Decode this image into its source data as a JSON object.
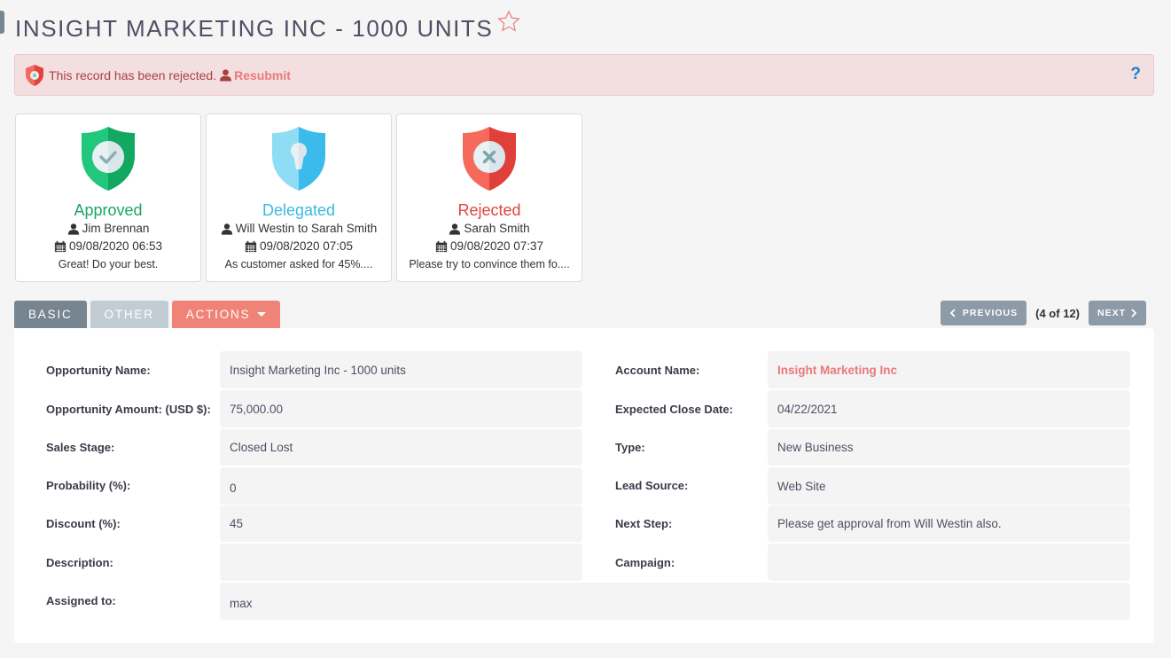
{
  "header": {
    "title": "INSIGHT MARKETING INC - 1000 UNITS",
    "favorite_icon": "star-outline-icon"
  },
  "alert": {
    "icon": "shield-reject-icon",
    "message": "This record has been rejected.",
    "action_icon": "user-icon",
    "action_label": "Resubmit",
    "help_label": "?"
  },
  "approvals": [
    {
      "status": "Approved",
      "color": "#1aa766",
      "user": "Jim Brennan",
      "datetime": "09/08/2020 06:53",
      "comment": "Great! Do your best.",
      "icon": "shield-check-icon"
    },
    {
      "status": "Delegated",
      "color": "#3db8e2",
      "user": "Will Westin to Sarah Smith",
      "datetime": "09/08/2020 07:05",
      "comment": "As customer asked for 45%....",
      "icon": "shield-keyhole-icon"
    },
    {
      "status": "Rejected",
      "color": "#e0443e",
      "user": "Sarah Smith",
      "datetime": "09/08/2020 07:37",
      "comment": "Please try to convince them fo....",
      "icon": "shield-x-icon"
    }
  ],
  "tabs": [
    {
      "label": "BASIC",
      "active": true
    },
    {
      "label": "OTHER",
      "active": false
    },
    {
      "label": "ACTIONS",
      "dropdown": true
    }
  ],
  "pager": {
    "previous_label": "PREVIOUS",
    "next_label": "NEXT",
    "position": "(4 of 12)"
  },
  "fields": {
    "left": [
      {
        "label": "Opportunity Name:",
        "value": "Insight Marketing Inc - 1000 units"
      },
      {
        "label": "Opportunity Amount: (USD $):",
        "value": "75,000.00"
      },
      {
        "label": "Sales Stage:",
        "value": "Closed Lost"
      },
      {
        "label": "Probability (%):",
        "value": "0"
      },
      {
        "label": "Discount (%):",
        "value": "45"
      },
      {
        "label": "Description:",
        "value": ""
      }
    ],
    "right": [
      {
        "label": "Account Name:",
        "value": "Insight Marketing Inc",
        "link": true
      },
      {
        "label": "Expected Close Date:",
        "value": "04/22/2021"
      },
      {
        "label": "Type:",
        "value": "New Business"
      },
      {
        "label": "Lead Source:",
        "value": "Web Site"
      },
      {
        "label": "Next Step:",
        "value": "Please get approval from Will Westin also."
      },
      {
        "label": "Campaign:",
        "value": ""
      }
    ],
    "assigned": {
      "label": "Assigned to:",
      "value": "max"
    }
  }
}
